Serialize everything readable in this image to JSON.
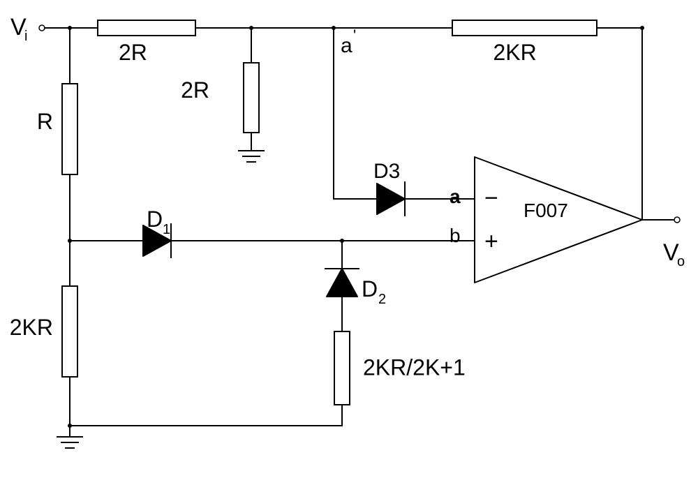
{
  "labels": {
    "vin": "V",
    "vin_sub": "i",
    "vout": "V",
    "vout_sub": "o",
    "r_top": "2R",
    "r_left_upper": "R",
    "r_mid_vert": "2R",
    "r_feedback": "2KR",
    "r_left_lower": "2KR",
    "r_divider": "2KR/2K+1",
    "d1": "D",
    "d1_sub": "1",
    "d2": "D",
    "d2_sub": "2",
    "d3": "D3",
    "opamp_minus": "−",
    "opamp_plus": "+",
    "opamp_part": "F007",
    "node_a_prime": "a",
    "node_a_prime_sup": "'",
    "node_a": "a",
    "node_b": "b"
  },
  "geom": {
    "wire_w": 2,
    "term_r": 4,
    "junc_r": 3
  }
}
